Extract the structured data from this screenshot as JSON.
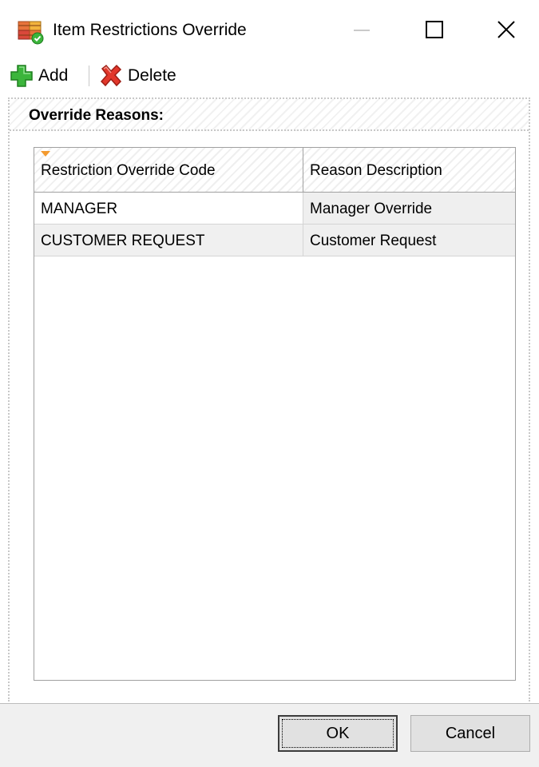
{
  "window": {
    "title": "Item Restrictions Override",
    "app_icon": "restriction-boxes-icon",
    "controls": {
      "minimize_icon": "minimize-icon",
      "maximize_icon": "maximize-icon",
      "close_icon": "close-icon"
    }
  },
  "toolbar": {
    "add_label": "Add",
    "add_icon": "green-plus-icon",
    "delete_label": "Delete",
    "delete_icon": "red-x-icon"
  },
  "group": {
    "title": "Override Reasons:"
  },
  "grid": {
    "columns": [
      {
        "label": "Restriction Override Code",
        "sorted": true
      },
      {
        "label": "Reason Description"
      }
    ],
    "rows": [
      [
        "MANAGER",
        "Manager Override"
      ],
      [
        "CUSTOMER REQUEST",
        "Customer Request"
      ]
    ]
  },
  "footer": {
    "ok_label": "OK",
    "cancel_label": "Cancel"
  },
  "colors": {
    "add_green": "#3bb53b",
    "delete_red": "#e2372b",
    "sort_marker": "#f39a2f",
    "grid_border": "#a0a0a0",
    "footer_bg": "#f0f0f0"
  }
}
